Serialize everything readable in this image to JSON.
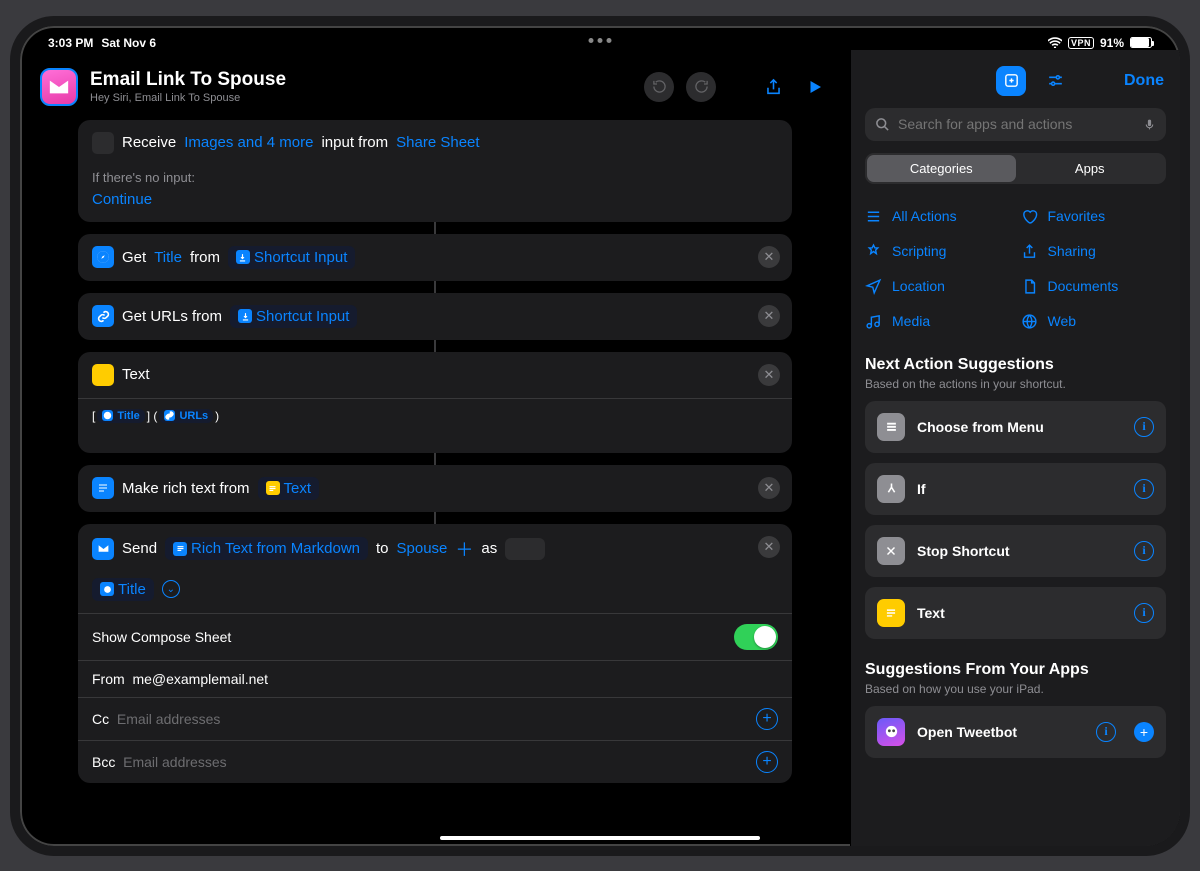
{
  "status": {
    "time": "3:03 PM",
    "date": "Sat Nov 6",
    "vpn": "VPN",
    "battery": "91%"
  },
  "header": {
    "title": "Email Link To Spouse",
    "subtitle": "Hey Siri, Email Link To Spouse"
  },
  "actions": {
    "receive": {
      "verb": "Receive",
      "types": "Images and 4 more",
      "mid": "input from",
      "source": "Share Sheet",
      "noinput_label": "If there's no input:",
      "noinput_action": "Continue"
    },
    "getTitle": {
      "verb": "Get",
      "prop": "Title",
      "from": "from",
      "var": "Shortcut Input"
    },
    "getUrls": {
      "verb": "Get URLs from",
      "var": "Shortcut Input"
    },
    "text": {
      "label": "Text",
      "token1": "Title",
      "token2": "URLs"
    },
    "richtext": {
      "verb": "Make rich text from",
      "var": "Text"
    },
    "send": {
      "verb": "Send",
      "var1": "Rich Text from Markdown",
      "to": "to",
      "recipient": "Spouse",
      "as": "as",
      "subject": "Title"
    },
    "params": {
      "compose_label": "Show Compose Sheet",
      "from_label": "From",
      "from_val": "me@examplemail.net",
      "cc_label": "Cc",
      "bcc_label": "Bcc",
      "placeholder": "Email addresses"
    }
  },
  "sidebar": {
    "done": "Done",
    "search_placeholder": "Search for apps and actions",
    "seg": {
      "a": "Categories",
      "b": "Apps"
    },
    "cats": {
      "all": "All Actions",
      "fav": "Favorites",
      "scripting": "Scripting",
      "sharing": "Sharing",
      "location": "Location",
      "documents": "Documents",
      "media": "Media",
      "web": "Web"
    },
    "next_title": "Next Action Suggestions",
    "next_sub": "Based on the actions in your shortcut.",
    "suggestions": [
      {
        "label": "Choose from Menu",
        "color": "#8e8e93"
      },
      {
        "label": "If",
        "color": "#8e8e93"
      },
      {
        "label": "Stop Shortcut",
        "color": "#8e8e93"
      },
      {
        "label": "Text",
        "color": "#ffcc00"
      }
    ],
    "apps_title": "Suggestions From Your Apps",
    "apps_sub": "Based on how you use your iPad.",
    "app_sugg": {
      "label": "Open Tweetbot"
    }
  }
}
